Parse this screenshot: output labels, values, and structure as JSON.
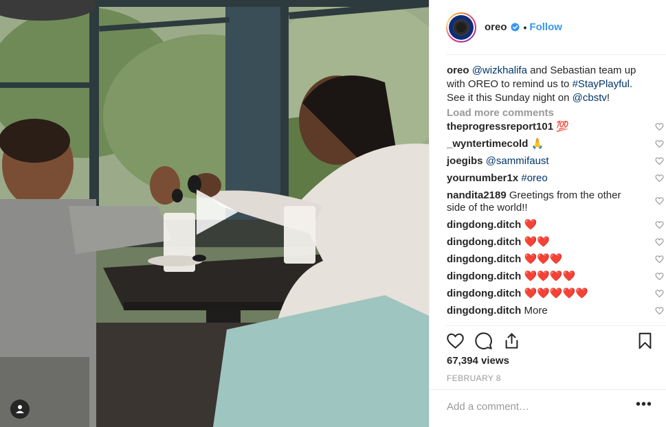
{
  "post": {
    "username": "oreo",
    "separator": "•",
    "follow_label": "Follow",
    "caption": {
      "author": "oreo",
      "parts": [
        {
          "type": "mention",
          "text": "@wizkhalifa"
        },
        {
          "type": "text",
          "text": " and Sebastian team up with OREO to remind us to "
        },
        {
          "type": "mention",
          "text": "#StayPlayful"
        },
        {
          "type": "text",
          "text": ". See it this Sunday night on "
        },
        {
          "type": "mention",
          "text": "@cbstv"
        },
        {
          "type": "text",
          "text": "!"
        }
      ]
    },
    "load_more_label": "Load more comments",
    "comments": [
      {
        "user": "theprogressreport101",
        "text": " 💯",
        "mention": ""
      },
      {
        "user": "_wyntertimecold",
        "text": " 🙏",
        "mention": ""
      },
      {
        "user": "joegibs",
        "text": "",
        "mention": "@sammifaust"
      },
      {
        "user": "yournumber1x",
        "text": "",
        "mention": "#oreo"
      },
      {
        "user": "nandita2189",
        "text": " Greetings from the other side of the world!!",
        "mention": ""
      },
      {
        "user": "dingdong.ditch",
        "text": " ❤️",
        "mention": ""
      },
      {
        "user": "dingdong.ditch",
        "text": " ❤️❤️",
        "mention": ""
      },
      {
        "user": "dingdong.ditch",
        "text": " ❤️❤️❤️",
        "mention": ""
      },
      {
        "user": "dingdong.ditch",
        "text": " ❤️❤️❤️❤️",
        "mention": ""
      },
      {
        "user": "dingdong.ditch",
        "text": " ❤️❤️❤️❤️❤️",
        "mention": ""
      },
      {
        "user": "dingdong.ditch",
        "text": " More",
        "mention": ""
      }
    ],
    "views_text": "67,394 views",
    "date": "FEBRUARY 8",
    "add_comment_placeholder": "Add a comment…",
    "options_label": "•••"
  },
  "icons": {
    "verified": "verified-badge-icon",
    "play": "play-icon",
    "user_tag": "user-tag-icon",
    "like": "heart-icon",
    "comment": "comment-icon",
    "share": "share-icon",
    "save": "bookmark-icon"
  },
  "colors": {
    "link": "#3897f0",
    "mention": "#003569",
    "muted": "#999999",
    "heart_emoji": "#ed4956"
  }
}
